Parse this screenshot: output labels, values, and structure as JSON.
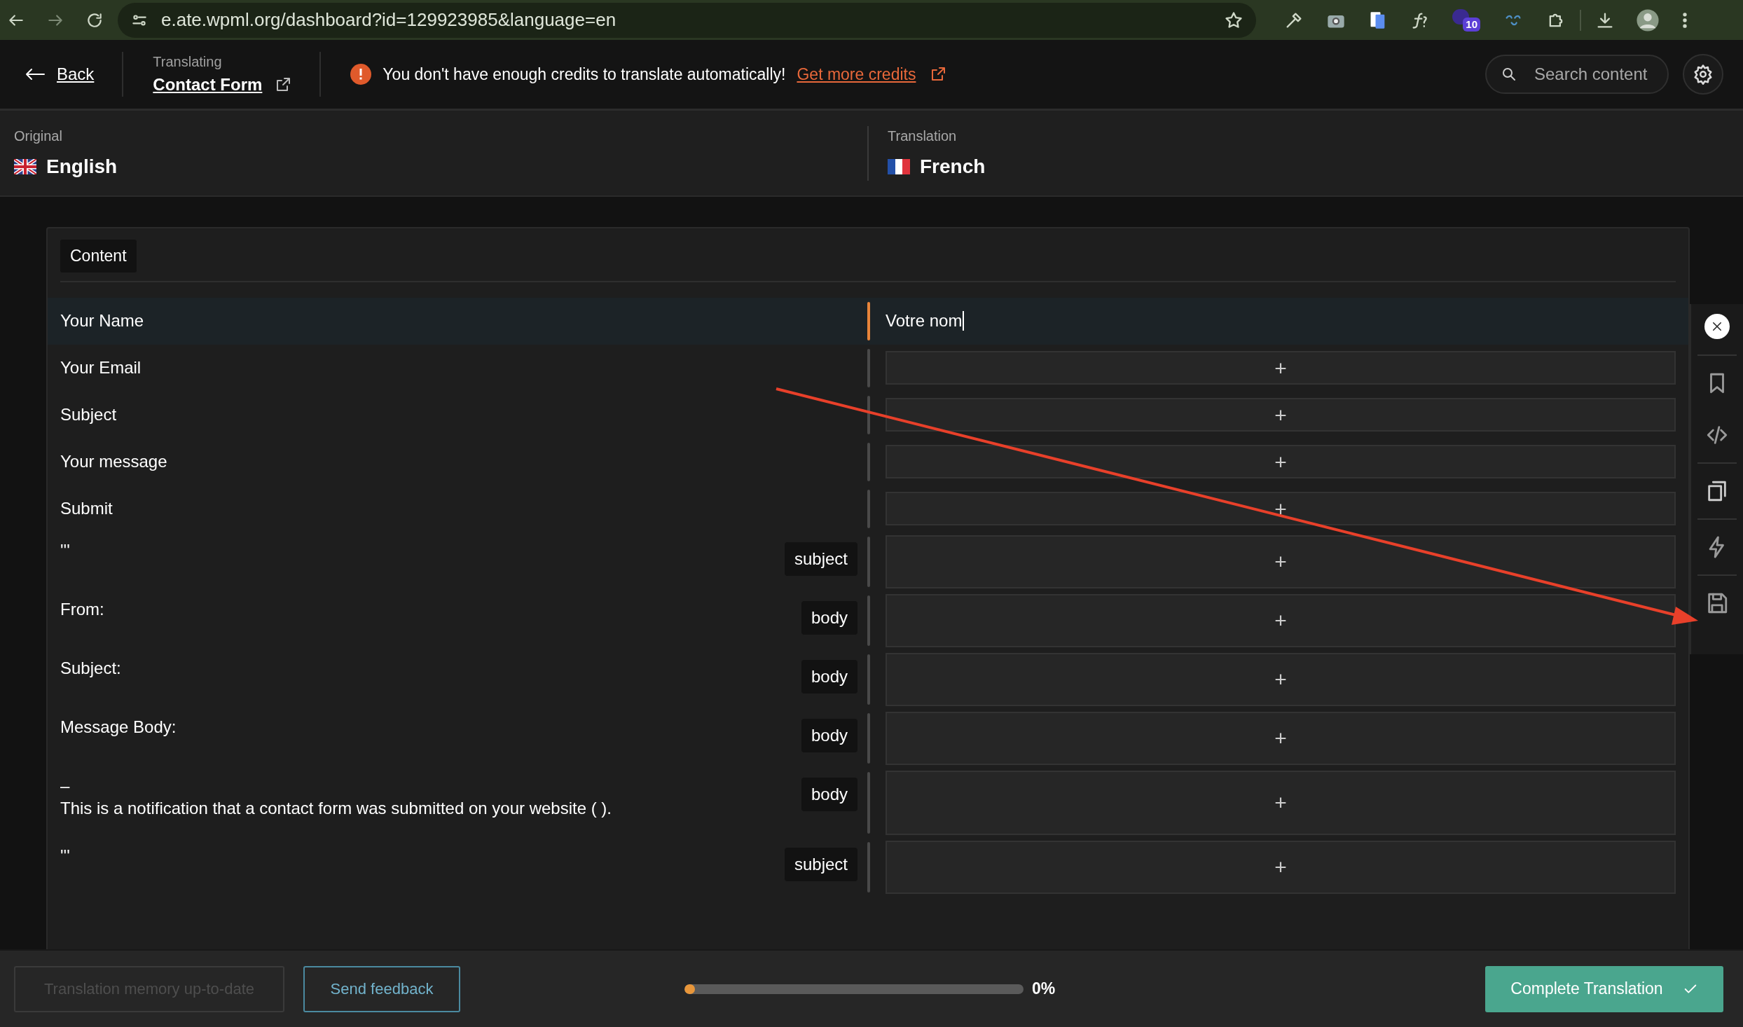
{
  "browser": {
    "url": "e.ate.wpml.org/dashboard?id=129923985&language=en",
    "extension_badge": "10"
  },
  "header": {
    "back": "Back",
    "translating_label": "Translating",
    "document_title": "Contact Form",
    "warning": "You don't have enough credits to translate automatically!",
    "credits_link": "Get more credits",
    "search": {
      "placeholder": "Search content"
    }
  },
  "languages": {
    "original_label": "Original",
    "original": "English",
    "translation_label": "Translation",
    "translation": "French"
  },
  "section_tab": "Content",
  "rows": [
    {
      "kind": "plain",
      "source": "Your Name",
      "translation": "Votre nom",
      "selected": true
    },
    {
      "kind": "plain",
      "source": "Your Email",
      "add": "+",
      "selected": false
    },
    {
      "kind": "plain",
      "source": "Subject",
      "add": "+",
      "selected": false
    },
    {
      "kind": "plain",
      "source": "Your message",
      "add": "+",
      "selected": false
    },
    {
      "kind": "plain",
      "source": "Submit",
      "add": "+",
      "selected": false
    },
    {
      "kind": "tagged",
      "source": "'''",
      "tag": "subject",
      "add": "+",
      "selected": false
    },
    {
      "kind": "tagged",
      "source": "From:",
      "tag": "body",
      "add": "+",
      "selected": false
    },
    {
      "kind": "tagged",
      "source": "Subject:",
      "tag": "body",
      "add": "+",
      "selected": false
    },
    {
      "kind": "tagged",
      "source": "Message Body:",
      "tag": "body",
      "add": "+",
      "selected": false
    },
    {
      "kind": "tall",
      "source": "–",
      "source_line2": "This is a notification that a contact form was submitted on your website ( ).",
      "tag": "body",
      "add": "+",
      "selected": false
    },
    {
      "kind": "tagged",
      "source": "'''",
      "tag": "subject",
      "add": "+",
      "selected": false
    }
  ],
  "footer": {
    "memory_button": {
      "label": "Translation memory up-to-date",
      "disabled": true
    },
    "feedback_button": "Send feedback",
    "progress": {
      "level": 0.03,
      "reading": "0%"
    },
    "complete_button": "Complete Translation"
  }
}
